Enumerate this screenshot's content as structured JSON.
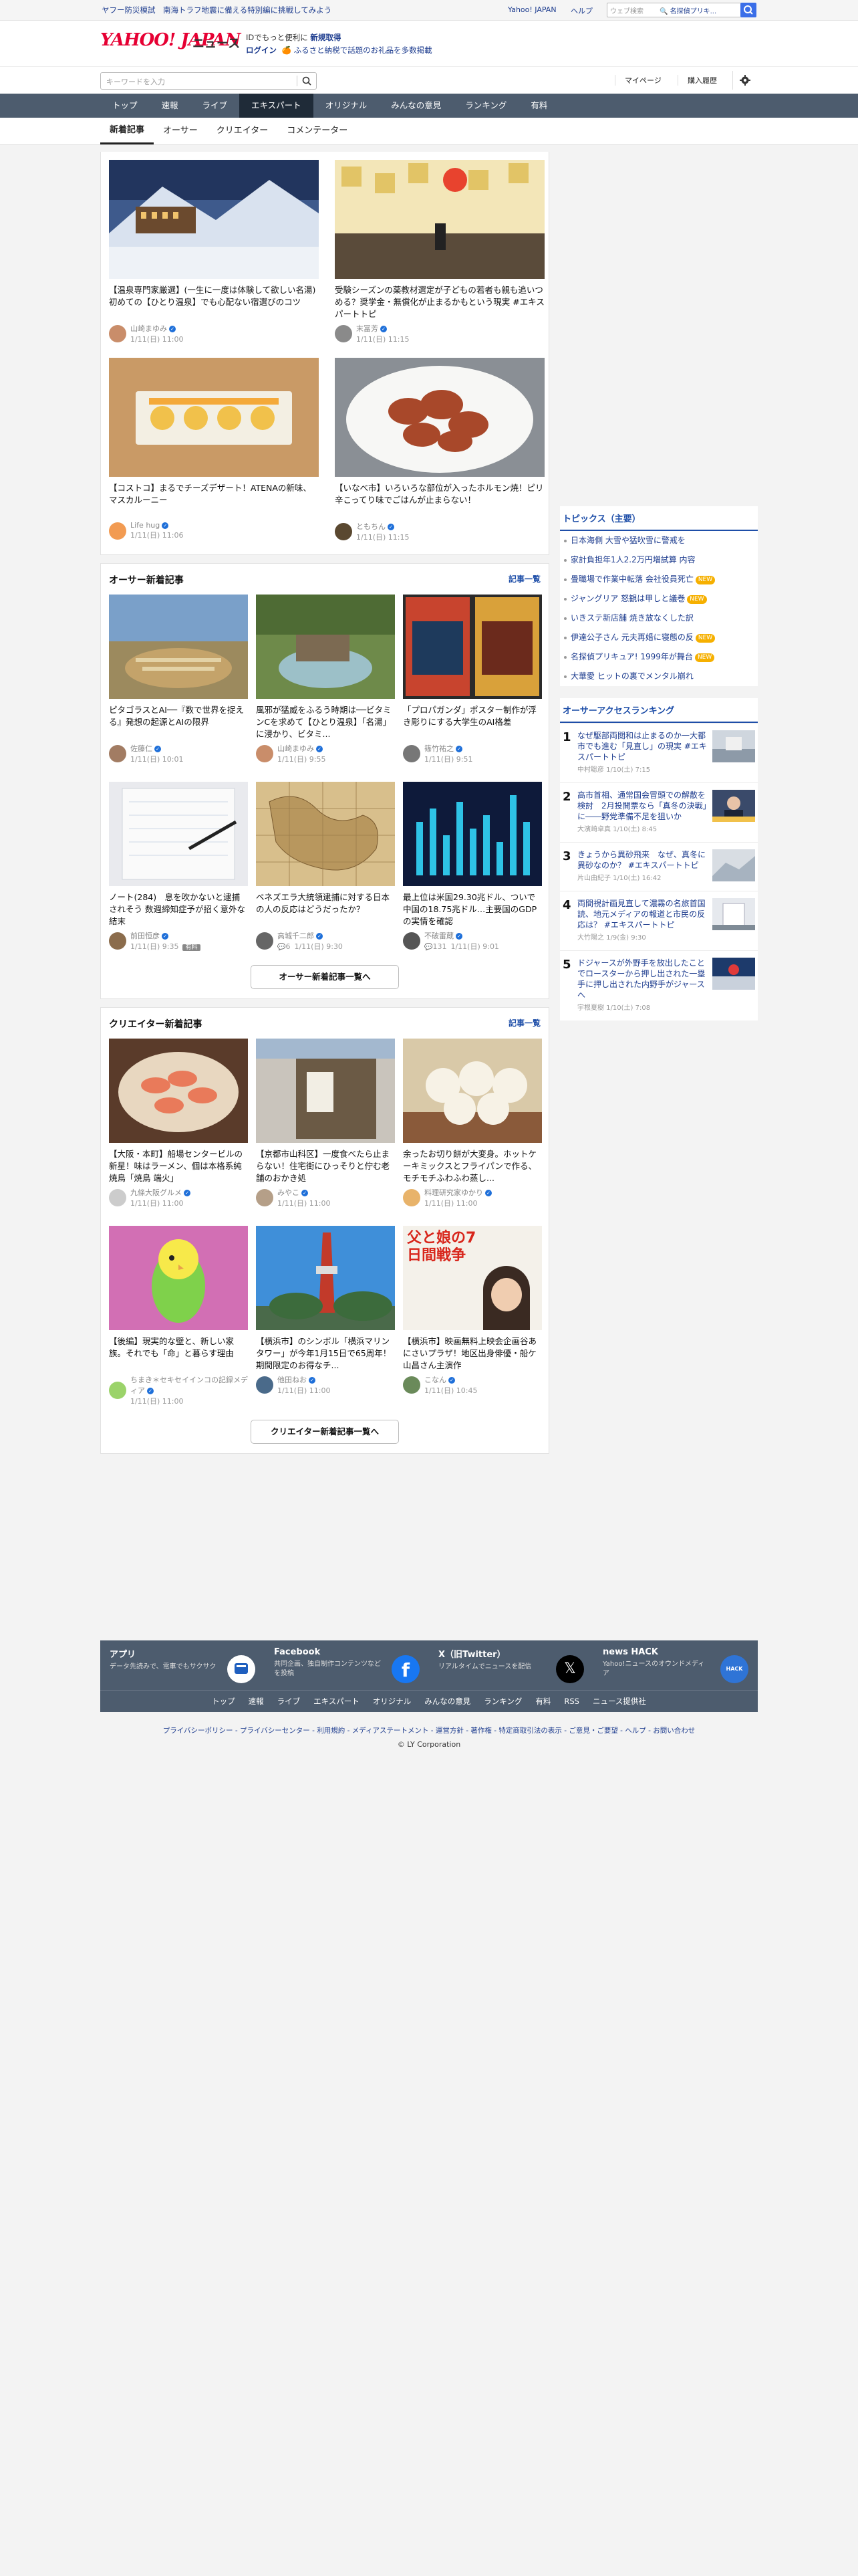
{
  "topbar": {
    "left_text": "ヤフー防災模試　南海トラフ地震に備える特別編に挑戦してみよう",
    "links": [
      "Yahoo! JAPAN",
      "ヘルプ"
    ],
    "search_placeholder": "ウェブ検索",
    "search_value": "🔍 名探偵プリキ..."
  },
  "header": {
    "logo": "YAHOO! JAPAN",
    "logo_sub": "ニュース",
    "promo_line1_prefix": "IDでもっと便利に",
    "promo_line1_link": "新規取得",
    "promo_line2_link": "ログイン",
    "promo_line2_text": "🍊 ふるさと納税で話題のお礼品を多数掲載"
  },
  "searchrow": {
    "placeholder": "キーワードを入力",
    "mypage": "マイページ",
    "history": "購入履歴"
  },
  "nav": {
    "items": [
      "トップ",
      "速報",
      "ライブ",
      "エキスパート",
      "オリジナル",
      "みんなの意見",
      "ランキング",
      "有料"
    ],
    "active": 3
  },
  "subtabs": {
    "items": [
      "新着記事",
      "オーサー",
      "クリエイター",
      "コメンテーター"
    ],
    "active": 0
  },
  "top_articles": [
    {
      "title": "【温泉専門家厳選】(一生に一度は体験して欲しい名湯) 初めての【ひとり温泉】でも心配ない宿選びのコツ",
      "author": "山崎まゆみ",
      "date": "1/11(日) 11:00"
    },
    {
      "title": "受験シーズンの薬教材選定が子どもの若者も親も追いつめる？奨学金・無償化が止まるかもという現実 #エキスパートトピ",
      "author": "末冨芳",
      "date": "1/11(日) 11:15"
    },
    {
      "title": "【コストコ】まるでチーズデザート！ATENAの新味、マスカルーニー",
      "author": "Life hug",
      "date": "1/11(日) 11:06"
    },
    {
      "title": "【いなべ市】いろいろな部位が入ったホルモン焼！ピリ辛こってり味でごはんが止まらない！",
      "author": "ともちん",
      "date": "1/11(日) 11:15"
    }
  ],
  "author_section": {
    "heading": "オーサー新着記事",
    "more": "記事一覧",
    "button": "オーサー新着記事一覧へ",
    "articles": [
      {
        "title": "ピタゴラスとAI──『数で世界を捉える』発想の起源とAIの限界",
        "author": "佐藤仁",
        "date": "1/11(日) 10:01"
      },
      {
        "title": "風邪が猛威をふるう時期は──ビタミンCを求めて【ひとり温泉】「名湯」に浸かり、ビタミ...",
        "author": "山崎まゆみ",
        "date": "1/11(日) 9:55"
      },
      {
        "title": "「プロパガンダ」ポスター制作が浮き彫りにする大学生のAI格差",
        "author": "篠竹祐之",
        "date": "1/11(日) 9:51"
      },
      {
        "title": "ノート(284)　息を吹かないと逮捕されそう 数週締知症予が招く意外な結末",
        "author": "前田恒彦",
        "date": "1/11(日) 9:35",
        "badge": "有料"
      },
      {
        "title": "ベネズエラ大統領逮捕に対する日本の人の反応はどうだったか？",
        "author": "高城千二郎",
        "date": "1/11(日) 9:30",
        "comments": "6"
      },
      {
        "title": "最上位は米国29.30兆ドル、ついで中国の18.75兆ドル…主要国のGDPの実情を確認",
        "author": "不破雷蔵",
        "date": "1/11(日) 9:01",
        "comments": "131"
      }
    ]
  },
  "creator_section": {
    "heading": "クリエイター新着記事",
    "more": "記事一覧",
    "button": "クリエイター新着記事一覧へ",
    "articles": [
      {
        "title": "【大阪・本町】船場センタービルの新星！味はラーメン、個は本格系純焼鳥「焼鳥 端火」",
        "author": "九條大阪グルメ",
        "date": "1/11(日) 11:00"
      },
      {
        "title": "【京都市山科区】一度食べたら止まらない！住宅街にひっそりと佇む老舗のおかき処",
        "author": "みやこ",
        "date": "1/11(日) 11:00"
      },
      {
        "title": "余ったお切り餅が大変身。ホットケーキミックスとフライパンで作る、モチモチふわふわ蒸し...",
        "author": "料理研究家ゆかり",
        "date": "1/11(日) 11:00"
      },
      {
        "title": "【後編】現実的な壁と、新しい家族。それでも「命」と暮らす理由",
        "author": "ちまき＊セキセイインコの記録メディア",
        "date": "1/11(日) 11:00"
      },
      {
        "title": "【横浜市】のシンボル「横浜マリンタワー」が今年1月15日で65周年！ 期間限定のお得なチ...",
        "author": "他田ねお",
        "date": "1/11(日) 11:00"
      },
      {
        "title": "【横浜市】映画無料上映会企画谷あにさいプラザ！地区出身俳優・船ケ山昌さん主演作",
        "author": "こなん",
        "date": "1/11(日) 10:45"
      }
    ]
  },
  "creator_image_text": "父と娘の7日間戦争",
  "sidebar": {
    "topics_heading": "トピックス（主要）",
    "topics": [
      {
        "text": "日本海側 大雪や猛吹雪に警戒を",
        "tag": ""
      },
      {
        "text": "家計負担年1人2.2万円増試算 内容",
        "tag": ""
      },
      {
        "text": "畳職場で作業中転落 会社役員死亡",
        "tag": "NEW"
      },
      {
        "text": "ジャングリア 怒観は甲しと議巻",
        "tag": "NEW"
      },
      {
        "text": "いきステ新店舗 焼き放なくした訳",
        "tag": ""
      },
      {
        "text": "伊達公子さん 元夫再婚に寝態の反",
        "tag": "NEW"
      },
      {
        "text": "名探偵プリキュア! 1999年が舞台",
        "tag": "NEW"
      },
      {
        "text": "大華愛 ヒットの裏でメンタル崩れ",
        "tag": ""
      }
    ],
    "ranking_heading": "オーサーアクセスランキング",
    "ranking": [
      {
        "num": "1",
        "title": "なぜ駆部両閲和は止まるのか一大都市でも進む「見直し」の現実 #エキスパートトピ",
        "meta": "中村聡彦 1/10(土) 7:15"
      },
      {
        "num": "2",
        "title": "高市首相、通常国会冒頭での解散を検討　2月投開票なら「真冬の決戦」に――野党準備不足を狙いか",
        "meta": "大濱崎卓真 1/10(土) 8:45"
      },
      {
        "num": "3",
        "title": "きょうから異砂飛来　なぜ、真冬に異砂なのか？ #エキスパートトピ",
        "meta": "片山由紀子 1/10(土) 16:42"
      },
      {
        "num": "4",
        "title": "両間視計画見直して濃霧の名旅首国読、地元メディアの報道と市民の反応は？ #エキスパートトピ",
        "meta": "大竹陽之 1/9(金) 9:30"
      },
      {
        "num": "5",
        "title": "ドジャースが外野手を放出したことでロースターから押し出された一塁手に押し出された内野手がジャースへ",
        "meta": "宇根夏樹 1/10(土) 7:08"
      }
    ]
  },
  "footer": {
    "boxes": [
      {
        "title": "アプリ",
        "desc": "データ先読みで、電車でもサクサク"
      },
      {
        "title": "Facebook",
        "desc": "共同企画、独自制作コンテンツなどを投稿"
      },
      {
        "title": "X（旧Twitter）",
        "desc": "リアルタイムでニュースを配信"
      },
      {
        "title": "news HACK",
        "desc": "Yahoo!ニュースのオウンドメディア"
      }
    ],
    "links": [
      "トップ",
      "速報",
      "ライブ",
      "エキスパート",
      "オリジナル",
      "みんなの意見",
      "ランキング",
      "有料",
      "RSS",
      "ニュース提供社"
    ],
    "legal": "プライバシーポリシー - プライバシーセンター - 利用規約 - メディアステートメント - 運営方針 - 著作権 - 特定商取引法の表示 - ご意見・ご要望 - ヘルプ - お問い合わせ",
    "copyright": "© LY Corporation"
  },
  "colors": {
    "nav": "#4d5c6e",
    "nav_active": "#1f2b38",
    "link": "#1e4ea8",
    "verified": "#1e6fd9",
    "new_tag": "#f6b000"
  }
}
